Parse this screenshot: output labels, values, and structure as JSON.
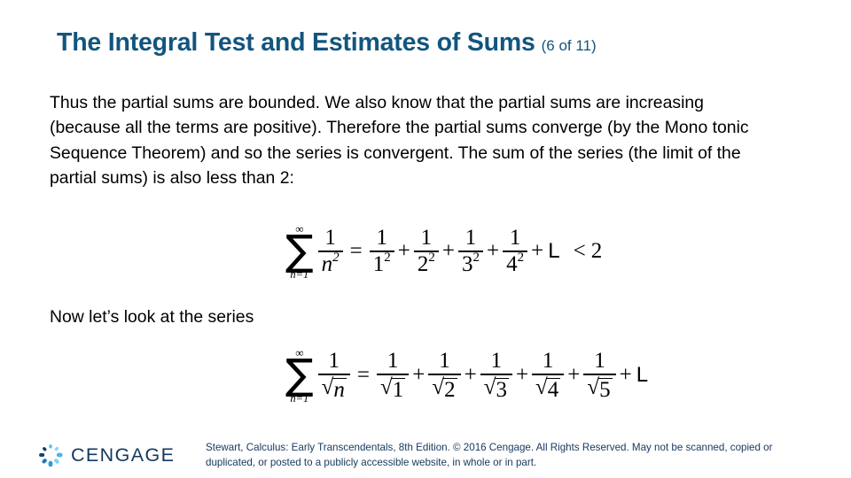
{
  "slide": {
    "background_color": "#ffffff",
    "title_color": "#12557d",
    "body_color": "#000000",
    "footer_color": "#17375e",
    "logo_word_color": "#13375c"
  },
  "title": {
    "main": "The Integral Test and Estimates of Sums",
    "count": "(6 of 11)"
  },
  "body": {
    "paragraph": "Thus the partial sums are bounded. We also know that the partial sums are increasing (because all the terms are positive). Therefore the partial sums converge (by the Mono tonic Sequence Theorem) and so the series is convergent. The sum of the series (the limit of the partial sums) is also less than 2:",
    "lead_line": "Now let’s look at the series"
  },
  "equation_1": {
    "latex": "\\sum_{n=1}^{\\infty} \\frac{1}{n^2} = \\frac{1}{1^2} + \\frac{1}{2^2} + \\frac{1}{3^2} + \\frac{1}{4^2} + L < 2",
    "plain": "sum n=1 to infinity of 1/n^2 = 1/1^2 + 1/2^2 + 1/3^2 + 1/4^2 + L < 2",
    "sigma_glyph": "∑",
    "upper_limit": "∞",
    "lower_limit": "n=1",
    "lhs_num": "1",
    "lhs_den_base": "n",
    "lhs_den_exp": "2",
    "equals": "=",
    "terms": [
      {
        "num": "1",
        "den_base": "1",
        "den_exp": "2"
      },
      {
        "num": "1",
        "den_base": "2",
        "den_exp": "2"
      },
      {
        "num": "1",
        "den_base": "3",
        "den_exp": "2"
      },
      {
        "num": "1",
        "den_base": "4",
        "den_exp": "2"
      }
    ],
    "plus": "+",
    "ellipsis_glyph": "L",
    "comparison_op": "<",
    "comparison_value": "2"
  },
  "equation_2": {
    "latex": "\\sum_{n=1}^{\\infty} \\frac{1}{\\sqrt{n}} = \\frac{1}{\\sqrt{1}} + \\frac{1}{\\sqrt{2}} + \\frac{1}{\\sqrt{3}} + \\frac{1}{\\sqrt{4}} + \\frac{1}{\\sqrt{5}} + L",
    "plain": "sum n=1 to infinity of 1/sqrt(n) = 1/sqrt(1) + 1/sqrt(2) + 1/sqrt(3) + 1/sqrt(4) + 1/sqrt(5) + L",
    "sigma_glyph": "∑",
    "upper_limit": "∞",
    "lower_limit": "n=1",
    "radical_glyph": "√",
    "lhs_num": "1",
    "lhs_den_radicand": "n",
    "equals": "=",
    "terms": [
      {
        "num": "1",
        "radicand": "1"
      },
      {
        "num": "1",
        "radicand": "2"
      },
      {
        "num": "1",
        "radicand": "3"
      },
      {
        "num": "1",
        "radicand": "4"
      },
      {
        "num": "1",
        "radicand": "5"
      }
    ],
    "plus": "+",
    "ellipsis_glyph": "L"
  },
  "footer": {
    "logo_word": "CENGAGE",
    "attribution": "Stewart, Calculus: Early Transcendentals, 8th Edition. © 2016 Cengage. All Rights Reserved. May not be scanned, copied or duplicated, or posted to a publicly accessible website, in whole or in part."
  }
}
